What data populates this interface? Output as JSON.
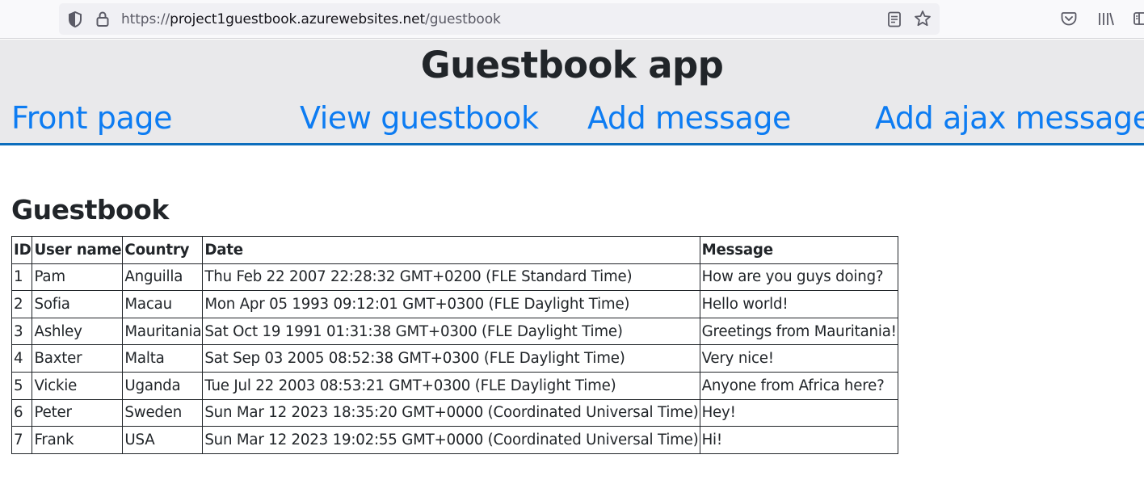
{
  "browser": {
    "url_prefix": "https://",
    "url_host": "project1guestbook.azurewebsites.net",
    "url_path": "/guestbook",
    "icons": [
      "shield-icon",
      "lock-icon",
      "reader-view-icon",
      "bookmark-star-icon",
      "pocket-icon",
      "library-icon",
      "sidebar-icon"
    ]
  },
  "header": {
    "title": "Guestbook app",
    "nav": [
      {
        "label": "Front page"
      },
      {
        "label": "View guestbook"
      },
      {
        "label": "Add message"
      },
      {
        "label": "Add ajax message"
      }
    ],
    "colors": {
      "link": "#0d7cf2",
      "header_bg": "#e9e9eb",
      "header_border": "#0d6ebd"
    }
  },
  "main": {
    "title": "Guestbook",
    "table": {
      "columns": [
        "ID",
        "User name",
        "Country",
        "Date",
        "Message"
      ],
      "rows": [
        [
          "1",
          "Pam",
          "Anguilla",
          "Thu Feb 22 2007 22:28:32 GMT+0200 (FLE Standard Time)",
          "How are you guys doing?"
        ],
        [
          "2",
          "Sofia",
          "Macau",
          "Mon Apr 05 1993 09:12:01 GMT+0300 (FLE Daylight Time)",
          "Hello world!"
        ],
        [
          "3",
          "Ashley",
          "Mauritania",
          "Sat Oct 19 1991 01:31:38 GMT+0300 (FLE Daylight Time)",
          "Greetings from Mauritania!"
        ],
        [
          "4",
          "Baxter",
          "Malta",
          "Sat Sep 03 2005 08:52:38 GMT+0300 (FLE Daylight Time)",
          "Very nice!"
        ],
        [
          "5",
          "Vickie",
          "Uganda",
          "Tue Jul 22 2003 08:53:21 GMT+0300 (FLE Daylight Time)",
          "Anyone from Africa here?"
        ],
        [
          "6",
          "Peter",
          "Sweden",
          "Sun Mar 12 2023 18:35:20 GMT+0000 (Coordinated Universal Time)",
          "Hey!"
        ],
        [
          "7",
          "Frank",
          "USA",
          "Sun Mar 12 2023 19:02:55 GMT+0000 (Coordinated Universal Time)",
          "Hi!"
        ]
      ]
    }
  }
}
